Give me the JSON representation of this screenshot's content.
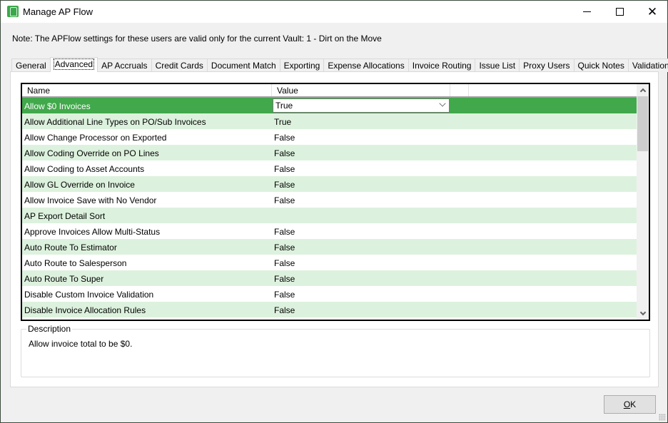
{
  "window": {
    "title": "Manage AP Flow",
    "icon": "app-logo-icon",
    "controls": {
      "minimize": "minimize-icon",
      "maximize": "maximize-icon",
      "close": "close-icon"
    }
  },
  "note": "Note:  The APFlow settings for these users are valid only for the current Vault: 1 - Dirt on the Move",
  "tabs": [
    {
      "label": "General",
      "active": false
    },
    {
      "label": "Advanced",
      "active": true
    },
    {
      "label": "AP Accruals",
      "active": false
    },
    {
      "label": "Credit Cards",
      "active": false
    },
    {
      "label": "Document Match",
      "active": false
    },
    {
      "label": "Exporting",
      "active": false
    },
    {
      "label": "Expense Allocations",
      "active": false
    },
    {
      "label": "Invoice Routing",
      "active": false
    },
    {
      "label": "Issue List",
      "active": false
    },
    {
      "label": "Proxy Users",
      "active": false
    },
    {
      "label": "Quick Notes",
      "active": false
    },
    {
      "label": "Validation",
      "active": false
    }
  ],
  "grid": {
    "columns": [
      "Name",
      "Value"
    ],
    "rows": [
      {
        "name": "Allow $0 Invoices",
        "value": "True",
        "selected": true
      },
      {
        "name": "Allow Additional Line Types on PO/Sub Invoices",
        "value": "True"
      },
      {
        "name": "Allow Change Processor on Exported",
        "value": "False"
      },
      {
        "name": "Allow Coding Override on PO Lines",
        "value": "False"
      },
      {
        "name": "Allow Coding to Asset Accounts",
        "value": "False"
      },
      {
        "name": "Allow GL Override on Invoice",
        "value": "False"
      },
      {
        "name": "Allow Invoice Save with No Vendor",
        "value": "False"
      },
      {
        "name": "AP Export Detail Sort",
        "value": ""
      },
      {
        "name": "Approve Invoices Allow Multi-Status",
        "value": "False"
      },
      {
        "name": "Auto Route To Estimator",
        "value": "False"
      },
      {
        "name": "Auto Route to Salesperson",
        "value": "False"
      },
      {
        "name": "Auto Route To Super",
        "value": "False"
      },
      {
        "name": "Disable Custom Invoice Validation",
        "value": "False"
      },
      {
        "name": "Disable Invoice Allocation Rules",
        "value": "False"
      }
    ],
    "selected_row_color": "#41a84b",
    "alt_row_color": "#ddf2de"
  },
  "description": {
    "label": "Description",
    "text": "Allow invoice total to be $0."
  },
  "ok_button": {
    "label_underlined": "O",
    "label_rest": "K"
  }
}
